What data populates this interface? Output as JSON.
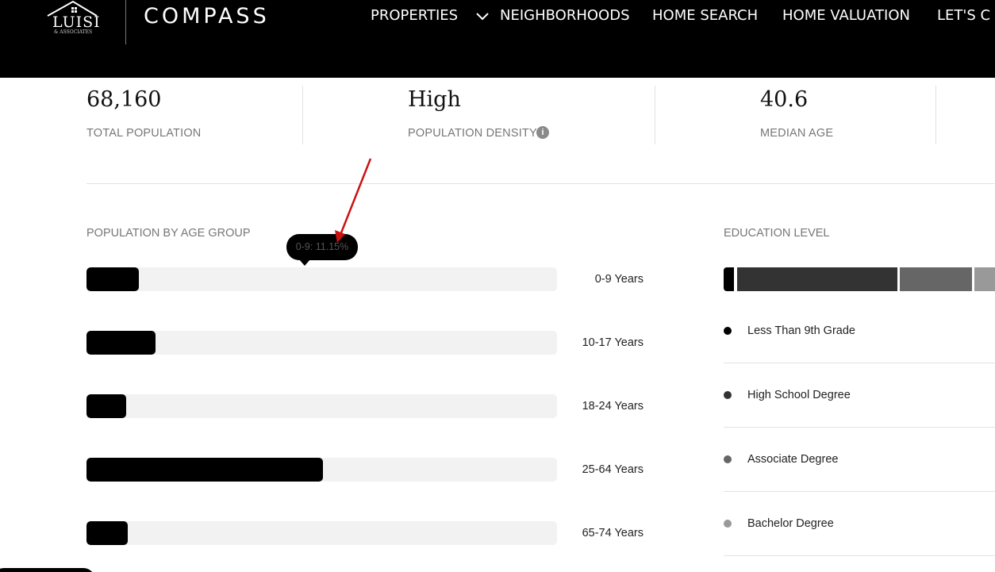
{
  "header": {
    "logo_luisi": "LUISI",
    "logo_associates": "& ASSOCIATES",
    "logo_compass": "COMPASS",
    "nav": [
      "PROPERTIES",
      "NEIGHBORHOODS",
      "HOME SEARCH",
      "HOME VALUATION",
      "LET'S C"
    ]
  },
  "stats": [
    {
      "value": "68,160",
      "label": "TOTAL POPULATION"
    },
    {
      "value": "High",
      "label": "POPULATION DENSITY"
    },
    {
      "value": "40.6",
      "label": "MEDIAN AGE"
    }
  ],
  "age_section": {
    "title": "POPULATION BY AGE GROUP",
    "tooltip": "0-9: 11.15%",
    "groups": [
      {
        "label": "0-9 Years",
        "percent": 11.15
      },
      {
        "label": "10-17 Years",
        "percent": 14.7
      },
      {
        "label": "18-24 Years",
        "percent": 8.4
      },
      {
        "label": "25-64 Years",
        "percent": 50.2
      },
      {
        "label": "65-74 Years",
        "percent": 8.8
      }
    ]
  },
  "education_section": {
    "title": "EDUCATION LEVEL",
    "levels": [
      {
        "label": "Less Than 9th Grade",
        "color": "#000000",
        "share": 4
      },
      {
        "label": "High School Degree",
        "color": "#333333",
        "share": 58
      },
      {
        "label": "Associate Degree",
        "color": "#666666",
        "share": 28
      },
      {
        "label": "Bachelor Degree",
        "color": "#999999",
        "share": 10
      }
    ]
  },
  "colors": {
    "header_bg": "#000000",
    "bar_track": "#f2f2f2",
    "bar_fill": "#000000",
    "annotation_arrow": "#cc1111"
  }
}
